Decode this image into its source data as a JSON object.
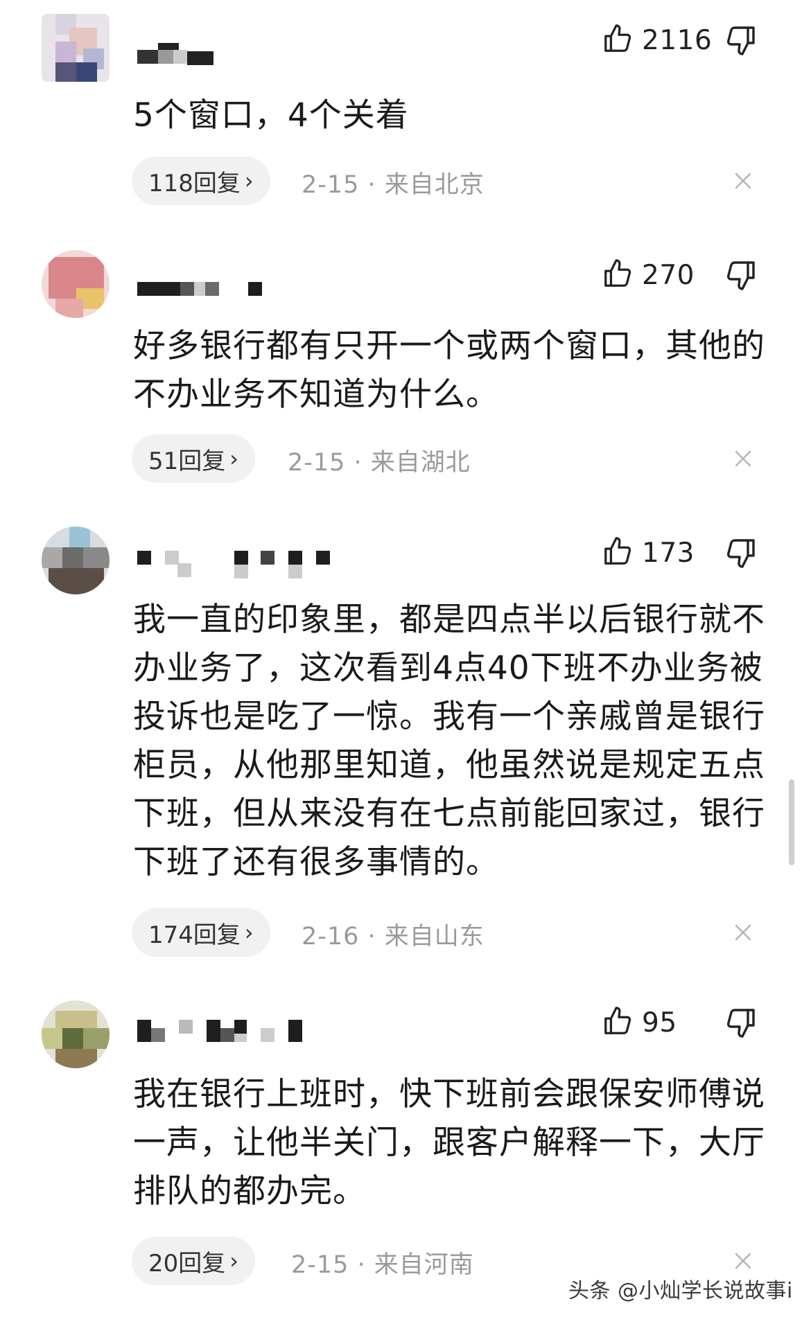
{
  "comments": [
    {
      "likes": "2116",
      "text": "5个窗口，4个关着",
      "replies": "118回复",
      "meta": "2-15 · 来自北京"
    },
    {
      "likes": "270",
      "text": "好多银行都有只开一个或两个窗口，其他的不办业务不知道为什么。",
      "replies": "51回复",
      "meta": "2-15 · 来自湖北"
    },
    {
      "likes": "173",
      "text": "我一直的印象里，都是四点半以后银行就不办业务了，这次看到4点40下班不办业务被投诉也是吃了一惊。我有一个亲戚曾是银行柜员，从他那里知道，他虽然说是规定五点下班，但从来没有在七点前能回家过，银行下班了还有很多事情的。",
      "replies": "174回复",
      "meta": "2-16 · 来自山东"
    },
    {
      "likes": "95",
      "text": "我在银行上班时，快下班前会跟保安师傅说一声，让他半关门，跟客户解释一下，大厅排队的都办完。",
      "replies": "20回复",
      "meta": "2-15 · 来自河南"
    }
  ],
  "icons": {
    "like": "thumbs-up-icon",
    "dislike": "thumbs-down-icon",
    "reply_chevron": "chevron-right-icon",
    "close": "close-icon"
  },
  "reply_chevron_glyph": "›",
  "watermark": "头条 @小灿学长说故事i"
}
